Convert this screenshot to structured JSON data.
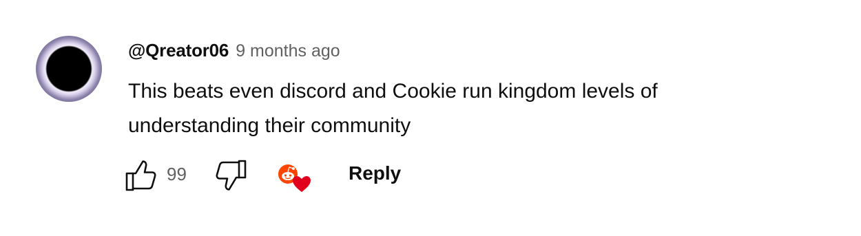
{
  "comment": {
    "author": "@Qreator06",
    "time": "9 months ago",
    "text_lines": [
      "This beats even discord and Cookie run kingdom levels of",
      "understanding their community"
    ],
    "like_count": "99",
    "reply_label": "Reply"
  },
  "icons": {
    "like": "thumbs-up-icon",
    "dislike": "thumbs-down-icon",
    "creator_heart": "creator-heart-icon"
  },
  "colors": {
    "text_primary": "#0f0f0f",
    "text_secondary": "#606060",
    "heart": "#e0001b",
    "creator_badge": "#ff4500"
  }
}
